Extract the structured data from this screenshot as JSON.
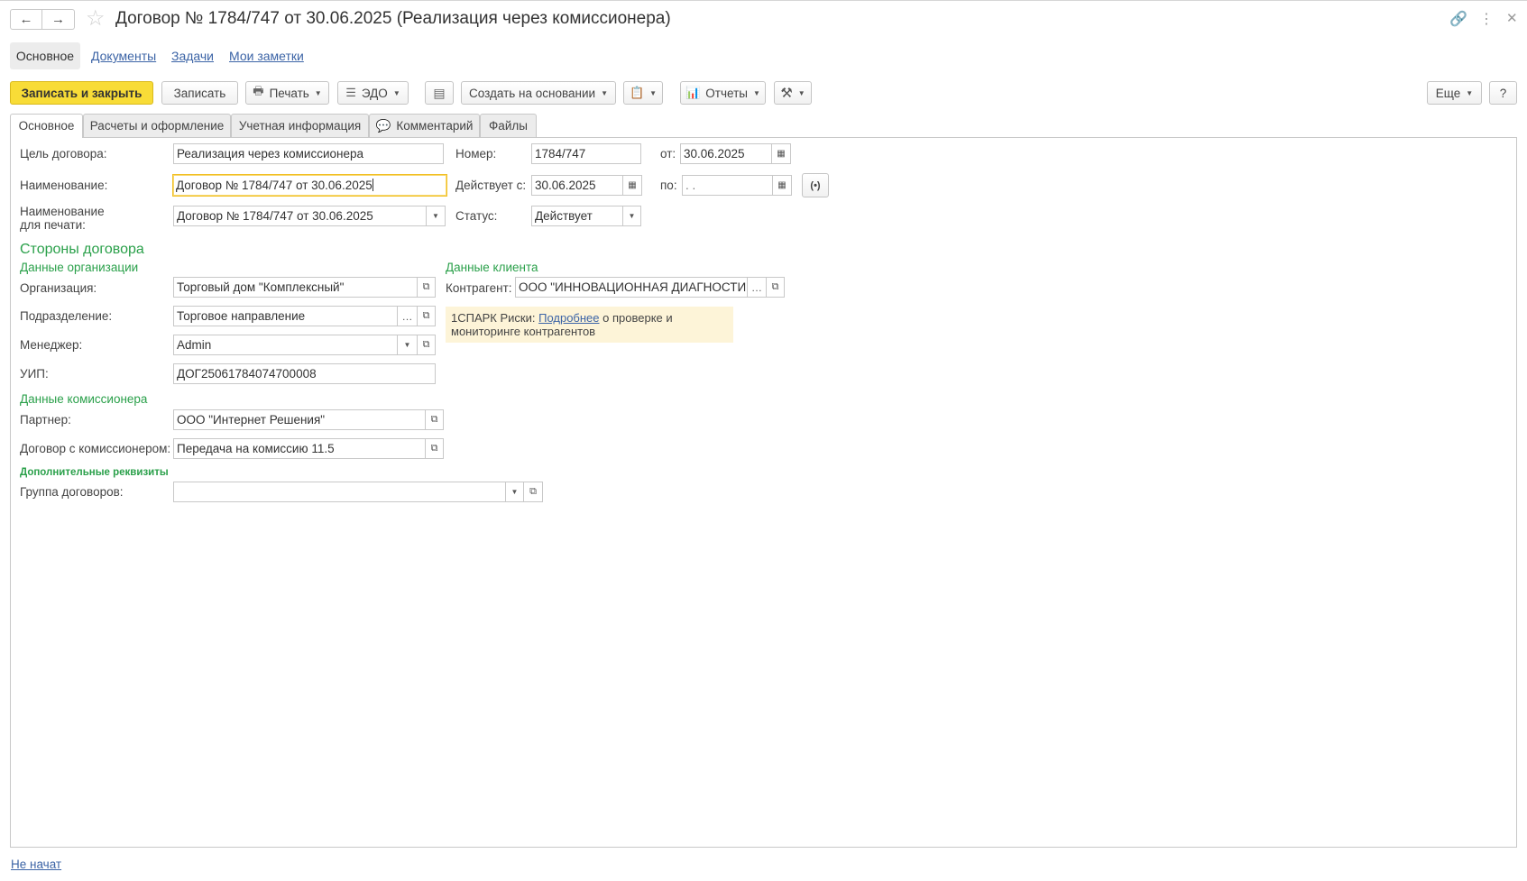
{
  "window": {
    "title": "Договор № 1784/747 от 30.06.2025 (Реализация через комиссионера)"
  },
  "sections": {
    "main": "Основное",
    "documents": "Документы",
    "tasks": "Задачи",
    "notes": "Мои заметки"
  },
  "toolbar": {
    "save_close": "Записать и закрыть",
    "save": "Записать",
    "print": "Печать",
    "edo": "ЭДО",
    "create_based": "Создать на основании",
    "reports": "Отчеты",
    "more": "Еще",
    "help": "?"
  },
  "tabs": {
    "main": "Основное",
    "calc": "Расчеты и оформление",
    "accounting": "Учетная информация",
    "comment": "Комментарий",
    "files": "Файлы"
  },
  "form": {
    "purpose_label": "Цель договора:",
    "purpose_value": "Реализация через комиссионера",
    "number_label": "Номер:",
    "number_value": "1784/747",
    "from_label": "от:",
    "from_value": "30.06.2025",
    "name_label": "Наименование:",
    "name_value": "Договор № 1784/747 от 30.06.2025",
    "valid_from_label": "Действует с:",
    "valid_from_value": "30.06.2025",
    "valid_to_label": "по:",
    "valid_to_value": " .  .",
    "print_name_label_1": "Наименование",
    "print_name_label_2": "для печати:",
    "print_name_value": "Договор № 1784/747 от 30.06.2025",
    "status_label": "Статус:",
    "status_value": "Действует"
  },
  "parties": {
    "header": "Стороны договора",
    "org_header": "Данные организации",
    "client_header": "Данные клиента",
    "org_label": "Организация:",
    "org_value": "Торговый дом \"Комплексный\"",
    "counterparty_label": "Контрагент:",
    "counterparty_value": "ООО \"ИННОВАЦИОННАЯ ДИАГНОСТИКА\"",
    "division_label": "Подразделение:",
    "division_value": "Торговое направление",
    "manager_label": "Менеджер:",
    "manager_value": "Admin",
    "uip_label": "УИП:",
    "uip_value": "ДОГ25061784074700008",
    "spark_prefix": "1СПАРК Риски: ",
    "spark_link": "Подробнее",
    "spark_suffix_1": " о проверке и",
    "spark_suffix_2": "мониторинге контрагентов"
  },
  "commission": {
    "header": "Данные комиссионера",
    "partner_label": "Партнер:",
    "partner_value": "ООО \"Интернет Решения\"",
    "contract_label": "Договор с комиссионером:",
    "contract_value": "Передача на комиссию 11.5"
  },
  "extra": {
    "header": "Дополнительные реквизиты",
    "group_label": "Группа договоров:",
    "group_value": ""
  },
  "status_bar": {
    "state": "Не начат"
  }
}
